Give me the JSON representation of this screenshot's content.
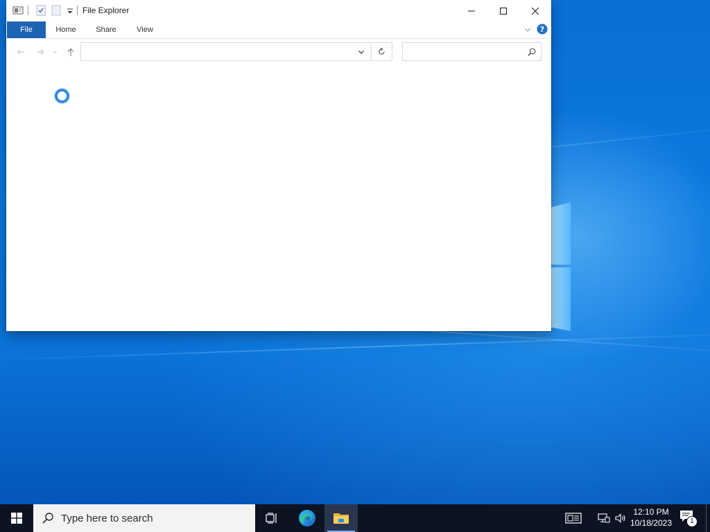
{
  "window": {
    "title": "File Explorer",
    "tabs": [
      "File",
      "Home",
      "Share",
      "View"
    ],
    "address_value": "",
    "search_placeholder": ""
  },
  "taskbar": {
    "search_placeholder": "Type here to search",
    "time": "12:10 PM",
    "date": "10/18/2023",
    "notification_count": "1"
  },
  "colors": {
    "file_tab": "#1e64b4",
    "desktop_blue": "#0a72d8",
    "taskbar": "#0c1424",
    "accent": "#2f8be0"
  },
  "icons": {
    "titlebar": [
      "properties-icon",
      "checkmark-icon",
      "new-folder-icon",
      "customize-dropdown-icon"
    ],
    "window_controls": [
      "minimize-icon",
      "maximize-icon",
      "close-icon"
    ],
    "taskbar": [
      "windows-start-icon",
      "search-icon",
      "task-view-icon",
      "edge-icon",
      "file-explorer-icon"
    ],
    "tray": [
      "news-icon",
      "network-icon",
      "volume-icon",
      "notification-icon"
    ]
  }
}
